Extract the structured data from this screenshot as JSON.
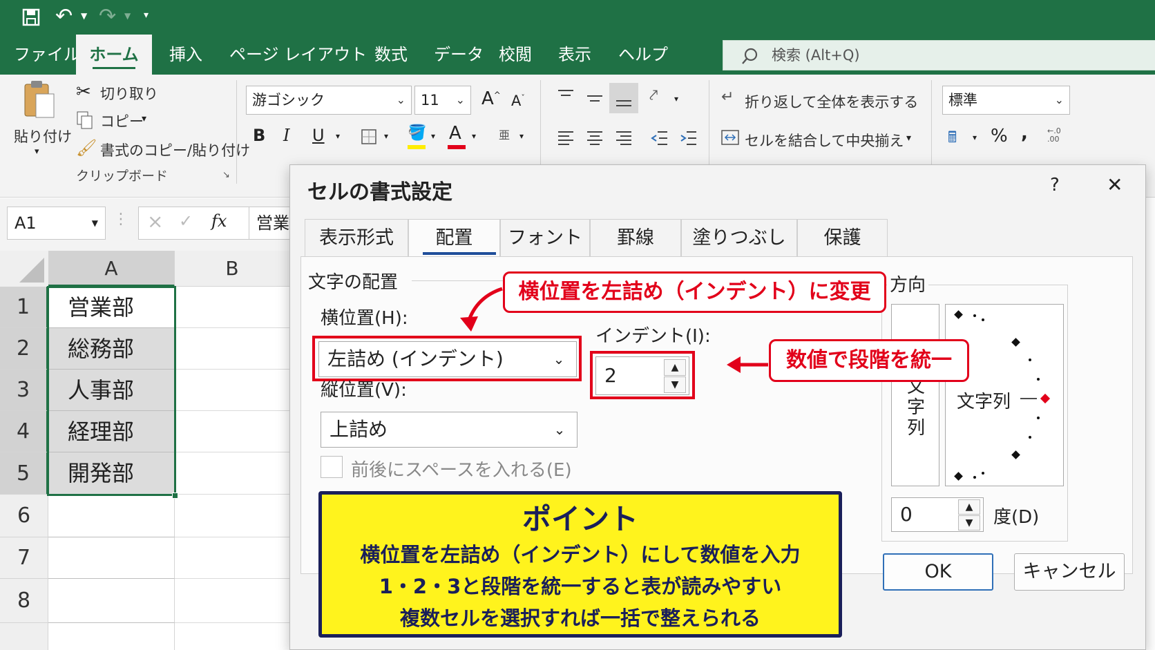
{
  "titlebar": {
    "qat": {
      "save": "save-icon",
      "undo": "undo-icon",
      "redo": "redo-icon",
      "customize": "customize-qat-icon"
    }
  },
  "menu": {
    "tabs": [
      "ファイル",
      "ホーム",
      "挿入",
      "ページ レイアウト",
      "数式",
      "データ",
      "校閲",
      "表示",
      "ヘルプ"
    ],
    "active": "ホーム",
    "search_placeholder": "検索 (Alt+Q)"
  },
  "ribbon": {
    "clipboard": {
      "paste": "貼り付け",
      "cut": "切り取り",
      "copy": "コピー",
      "format_painter": "書式のコピー/貼り付け",
      "group_label": "クリップボード"
    },
    "font": {
      "font_name": "游ゴシック",
      "font_size": "11",
      "bold": "B",
      "italic": "I",
      "underline": "U",
      "grow": "A",
      "shrink": "A",
      "font_color": "A"
    },
    "alignment": {
      "wrap_text": "折り返して全体を表示する",
      "merge_center": "セルを結合して中央揃え"
    },
    "number": {
      "format": "標準",
      "percent": "%",
      "comma": ","
    }
  },
  "formula_bar": {
    "name_box": "A1",
    "cancel": "×",
    "enter": "✓",
    "fx": "fx",
    "content": "営業"
  },
  "sheet": {
    "columns": [
      "A",
      "B"
    ],
    "rows": [
      "1",
      "2",
      "3",
      "4",
      "5",
      "6",
      "7",
      "8"
    ],
    "cells_a": [
      "営業部",
      "総務部",
      "人事部",
      "経理部",
      "開発部"
    ]
  },
  "dialog": {
    "title": "セルの書式設定",
    "help": "?",
    "close": "✕",
    "tabs": [
      "表示形式",
      "配置",
      "フォント",
      "罫線",
      "塗りつぶし",
      "保護"
    ],
    "active_tab": "配置",
    "section_alignment": "文字の配置",
    "horizontal_label": "横位置(H):",
    "horizontal_value": "左詰め (インデント)",
    "indent_label": "インデント(I):",
    "indent_value": "2",
    "vertical_label": "縦位置(V):",
    "vertical_value": "上詰め",
    "distributed_label": "前後にスペースを入れる(E)",
    "orientation_label": "方向",
    "vertical_text": [
      "文",
      "字",
      "列"
    ],
    "text_sample": "文字列",
    "degree_value": "0",
    "degree_label": "度(D)",
    "ok": "OK",
    "cancel": "キャンセル"
  },
  "annotations": {
    "callout_horizontal": "横位置を左詰め（インデント）に変更",
    "callout_indent": "数値で段階を統一",
    "point_title": "ポイント",
    "point_lines": [
      "横位置を左詰め（インデント）にして数値を入力",
      "1・2・3と段階を統一すると表が読みやすい",
      "複数セルを選択すれば一括で整えられる"
    ]
  },
  "colors": {
    "excel_green": "#1f7145",
    "callout_red": "#e2001a",
    "point_yellow": "#fff31d",
    "point_border": "#1a1f5a"
  }
}
